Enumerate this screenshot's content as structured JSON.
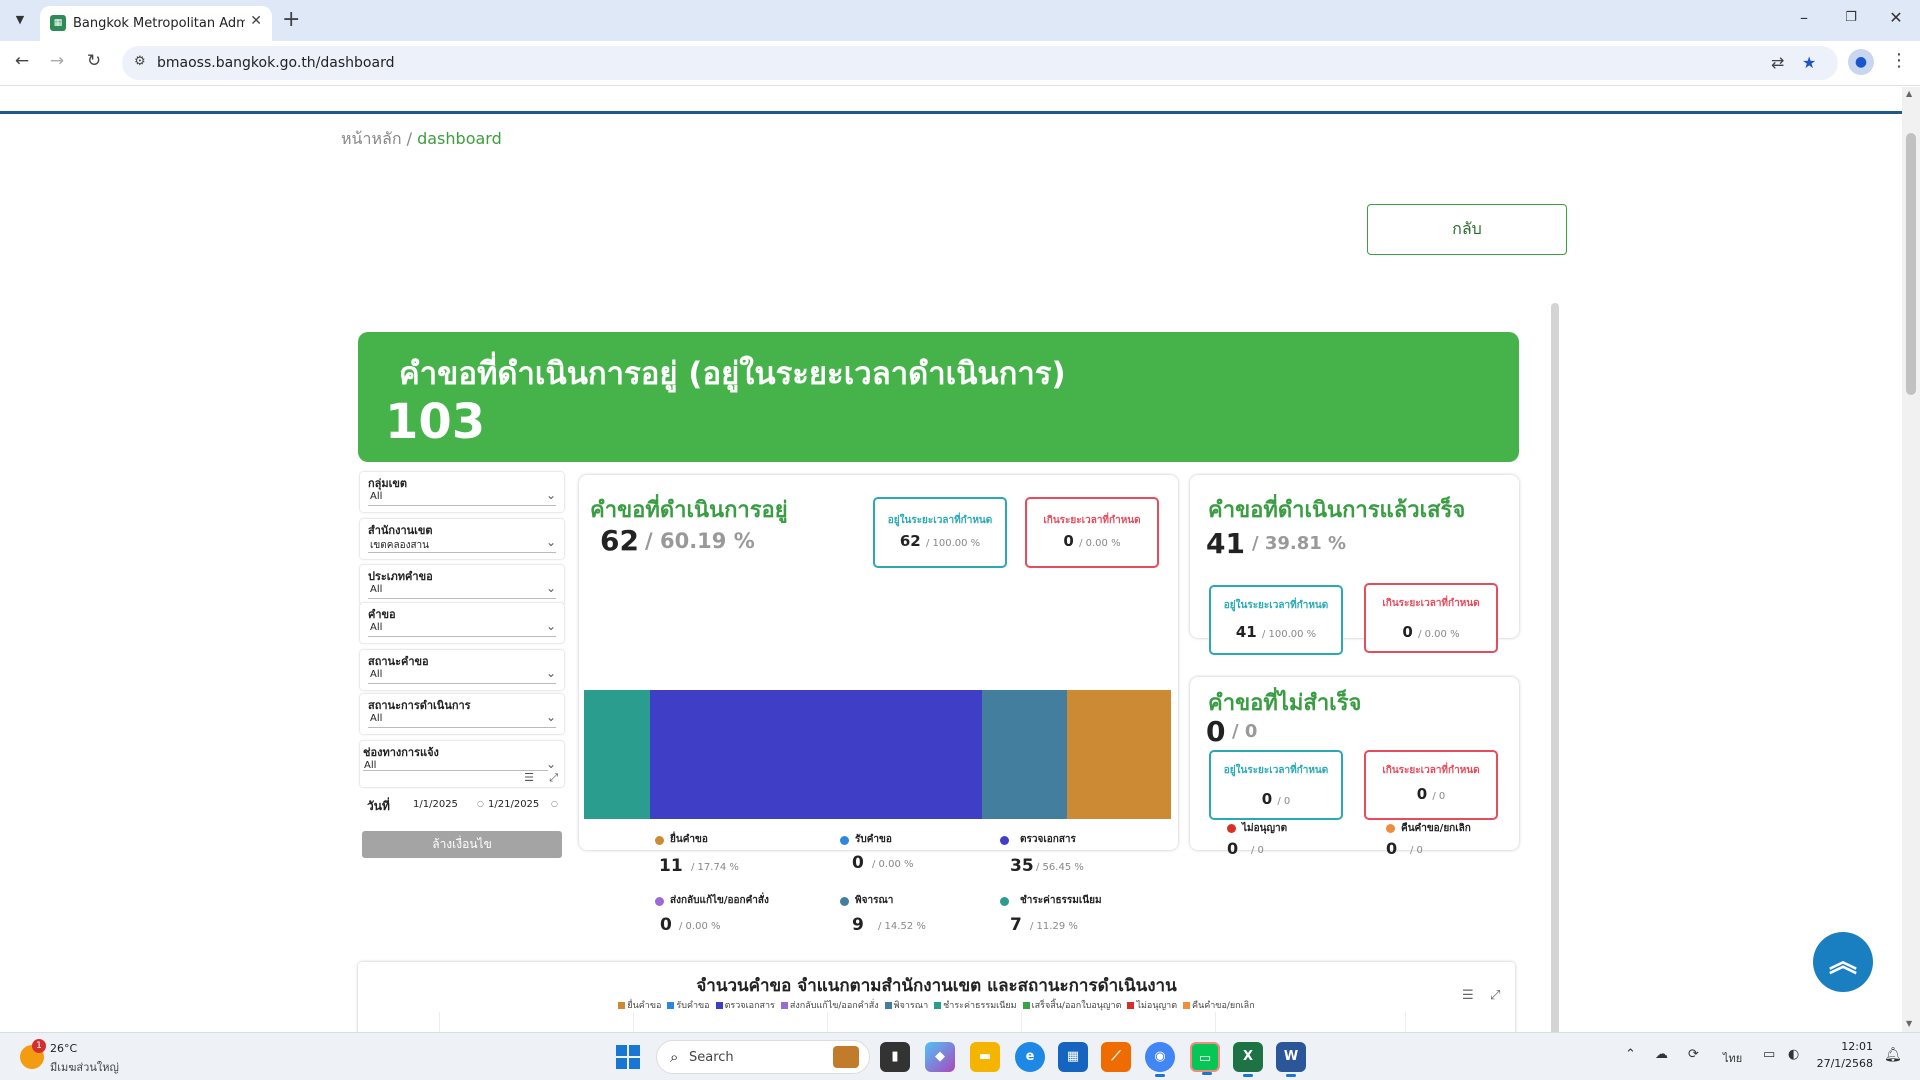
{
  "browser": {
    "tab_title": "Bangkok Metropolitan Administ",
    "url": "bmaoss.bangkok.go.th/dashboard"
  },
  "breadcrumb": {
    "home": "หน้าหลัก",
    "sep": "/",
    "current": "dashboard"
  },
  "back_button": "กลับ",
  "banner": {
    "title": "คำขอที่ดำเนินการอยู่ (อยู่ในระยะเวลาดำเนินการ)",
    "count": "103"
  },
  "filters": [
    {
      "label": "กลุ่มเขต",
      "value": "All"
    },
    {
      "label": "สำนักงานเขต",
      "value": "เขตคลองสาน"
    },
    {
      "label": "ประเภทคำขอ",
      "value": "All"
    },
    {
      "label": "คำขอ",
      "value": "All"
    },
    {
      "label": "สถานะคำขอ",
      "value": "All"
    },
    {
      "label": "สถานะการดำเนินการ",
      "value": "All"
    },
    {
      "label": "ช่องทางการแจ้ง",
      "value": "All"
    }
  ],
  "date_filter": {
    "label": "วันที่",
    "from": "1/1/2025",
    "to": "1/21/2025"
  },
  "clear_button": "ล้างเงื่อนไข",
  "in_progress": {
    "title": "คำขอที่ดำเนินการอยู่",
    "count": "62",
    "pct": "/ 60.19 %",
    "on_time": {
      "title": "อยู่ในระยะเวลาที่กำหนด",
      "value": "62",
      "pct": "/ 100.00 %"
    },
    "late": {
      "title": "เกินระยะเวลาที่กำหนด",
      "value": "0",
      "pct": "/ 0.00 %"
    }
  },
  "chart_data": {
    "type": "bar",
    "stacked": true,
    "orientation": "horizontal",
    "categories": [
      "ยื่นคำขอ",
      "รับคำขอ",
      "ตรวจเอกสาร",
      "ส่งกลับแก้ไข/ออกคำสั่ง",
      "พิจารณา",
      "ชำระค่าธรรมเนียม"
    ],
    "values": [
      11,
      0,
      35,
      0,
      9,
      7
    ],
    "percents": [
      "/ 17.74 %",
      "/ 0.00 %",
      "/ 56.45 %",
      "/ 0.00 %",
      "/ 14.52 %",
      "/ 11.29 %"
    ],
    "colors": [
      "#cc8a35",
      "#2e86de",
      "#3e3ec6",
      "#9b6ad6",
      "#437e9e",
      "#2a9d8f"
    ],
    "bar_order": [
      5,
      2,
      4,
      0
    ]
  },
  "completed": {
    "title": "คำขอที่ดำเนินการแล้วเสร็จ",
    "count": "41",
    "pct": "/ 39.81 %",
    "on_time": {
      "title": "อยู่ในระยะเวลาที่กำหนด",
      "value": "41",
      "pct": "/ 100.00 %"
    },
    "late": {
      "title": "เกินระยะเวลาที่กำหนด",
      "value": "0",
      "pct": "/ 0.00 %"
    }
  },
  "failed": {
    "title": "คำขอที่ไม่สำเร็จ",
    "count": "0",
    "total": "/ 0",
    "on_time": {
      "title": "อยู่ในระยะเวลาที่กำหนด",
      "value": "0",
      "pct": "/ 0"
    },
    "late": {
      "title": "เกินระยะเวลาที่กำหนด",
      "value": "0",
      "pct": "/ 0"
    },
    "denied": {
      "label": "ไม่อนุญาต",
      "value": "0",
      "total": "/ 0",
      "color": "#d93025"
    },
    "returned": {
      "label": "คืนคำขอ/ยกเลิก",
      "value": "0",
      "total": "/ 0",
      "color": "#f08c3a"
    }
  },
  "bottom_chart": {
    "title": "จำนวนคำขอ  จำแนกตามสำนักงานเขต และสถานะการดำเนินงาน",
    "legend": [
      {
        "label": "ยื่นคำขอ",
        "color": "#cc8a35"
      },
      {
        "label": "รับคำขอ",
        "color": "#2e86de"
      },
      {
        "label": "ตรวจเอกสาร",
        "color": "#3e3ec6"
      },
      {
        "label": "ส่งกลับแก้ไข/ออกคำสั่ง",
        "color": "#9b6ad6"
      },
      {
        "label": "พิจารณา",
        "color": "#437e9e"
      },
      {
        "label": "ชำระค่าธรรมเนียม",
        "color": "#2a9d8f"
      },
      {
        "label": "เสร็จสิ้น/ออกใบอนุญาต",
        "color": "#3aa34a"
      },
      {
        "label": "ไม่อนุญาต",
        "color": "#d93025"
      },
      {
        "label": "คืนคำขอ/ยกเลิก",
        "color": "#f08c3a"
      }
    ]
  },
  "taskbar": {
    "temp": "26°C",
    "weather_desc": "มีเมฆส่วนใหญ่",
    "weather_badge": "1",
    "search": "Search",
    "lang": "ไทย",
    "time": "12:01",
    "date": "27/1/2568"
  }
}
